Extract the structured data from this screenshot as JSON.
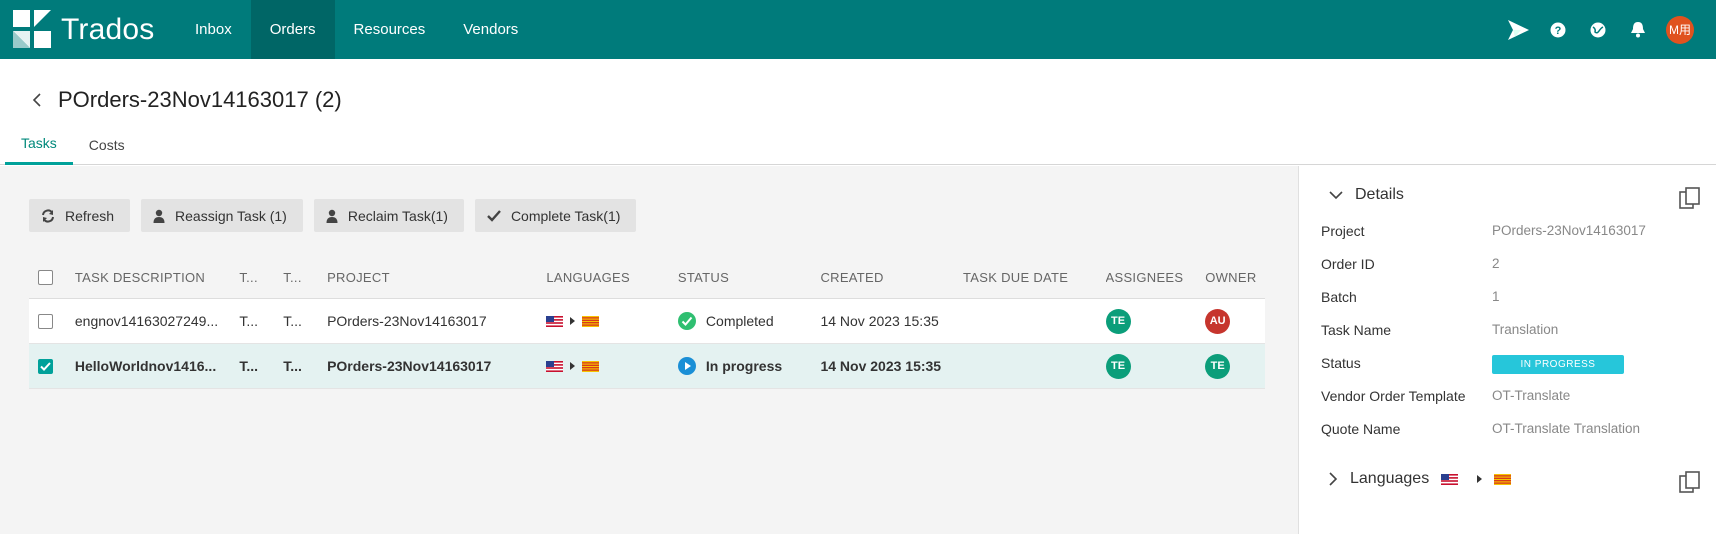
{
  "app": {
    "name": "Trados",
    "user_initials": "M用"
  },
  "nav": {
    "items": [
      {
        "label": "Inbox"
      },
      {
        "label": "Orders"
      },
      {
        "label": "Resources"
      },
      {
        "label": "Vendors"
      }
    ]
  },
  "header": {
    "title": "POrders-23Nov14163017 (2)"
  },
  "tabs": [
    {
      "label": "Tasks"
    },
    {
      "label": "Costs"
    }
  ],
  "toolbar": {
    "refresh": "Refresh",
    "reassign": "Reassign Task (1)",
    "reclaim": "Reclaim Task(1)",
    "complete": "Complete Task(1)"
  },
  "table": {
    "columns": [
      "TASK DESCRIPTION",
      "T...",
      "T...",
      "PROJECT",
      "LANGUAGES",
      "STATUS",
      "CREATED",
      "TASK DUE DATE",
      "ASSIGNEES",
      "OWNER"
    ],
    "rows": [
      {
        "checked": false,
        "description": "engnov14163027249...",
        "t1": "T...",
        "t2": "T...",
        "project": "POrders-23Nov14163017",
        "source_lang": "en-US",
        "target_lang": "ca-ES",
        "status": "Completed",
        "created": "14 Nov 2023 15:35",
        "due": "",
        "assignee": "TE",
        "owner": "AU"
      },
      {
        "checked": true,
        "description": "HelloWorldnov1416...",
        "t1": "T...",
        "t2": "T...",
        "project": "POrders-23Nov14163017",
        "source_lang": "en-US",
        "target_lang": "ca-ES",
        "status": "In progress",
        "created": "14 Nov 2023 15:35",
        "due": "",
        "assignee": "TE",
        "owner": "TE"
      }
    ]
  },
  "details": {
    "title": "Details",
    "fields": [
      {
        "label": "Project",
        "value": "POrders-23Nov14163017"
      },
      {
        "label": "Order ID",
        "value": "2"
      },
      {
        "label": "Batch",
        "value": "1"
      },
      {
        "label": "Task Name",
        "value": "Translation"
      },
      {
        "label": "Status",
        "value": "IN PROGRESS"
      },
      {
        "label": "Vendor Order Template",
        "value": "OT-Translate"
      },
      {
        "label": "Quote Name",
        "value": "OT-Translate Translation"
      }
    ],
    "languages_title": "Languages"
  },
  "colors": {
    "brand": "#007b7b",
    "accent": "#00a19a",
    "completed": "#2fbf71",
    "in_progress": "#1a8fd6",
    "status_pill": "#26c6da"
  },
  "icons": {
    "refresh": "refresh-icon",
    "reassign": "user-icon",
    "reclaim": "user-icon",
    "complete": "check-icon",
    "completed_status": "check-circle-icon",
    "in_progress_status": "play-circle-icon",
    "copy": "copy-icon"
  }
}
